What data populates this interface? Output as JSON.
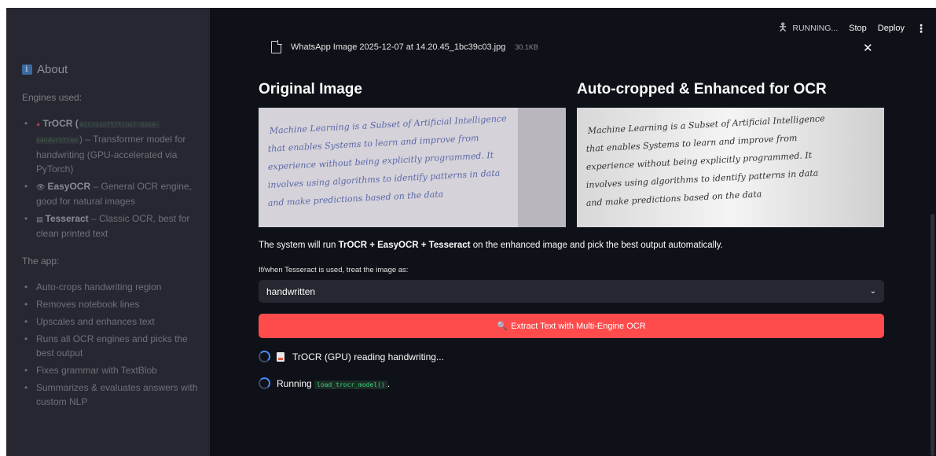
{
  "header": {
    "running_label": "RUNNING...",
    "stop_label": "Stop",
    "deploy_label": "Deploy",
    "menu_glyph": "⋮"
  },
  "sidebar": {
    "about_title": "About",
    "engines_heading": "Engines used:",
    "engines": [
      {
        "name": "TrOCR (",
        "code": "microsoft/trocr-base-handwritten",
        "desc": ") – Transformer model for handwriting (GPU-accelerated via PyTorch)"
      },
      {
        "name": "EasyOCR",
        "desc": " – General OCR engine, good for natural images"
      },
      {
        "name": "Tesseract",
        "desc": " – Classic OCR, best for clean printed text"
      }
    ],
    "app_heading": "The app:",
    "app_items": [
      "Auto-crops handwriting region",
      "Removes notebook lines",
      "Upscales and enhances text",
      "Runs all OCR engines and picks the best output",
      "Fixes grammar with TextBlob",
      "Summarizes & evaluates answers with custom NLP"
    ]
  },
  "file": {
    "name": "WhatsApp Image 2025-12-07 at 14.20.45_1bc39c03.jpg",
    "size": "30.1KB"
  },
  "original_heading": "Original Image",
  "enhanced_heading": "Auto-cropped & Enhanced for OCR",
  "handwriting_lines": [
    "Machine Learning is a Subset of Artificial Intelligence",
    "that enables Systems to learn and improve from",
    "experience without being explicitly programmed. It",
    "involves using algorithms to identify patterns in data",
    "and make predictions based on the data"
  ],
  "system_text": {
    "prefix": "The system will run ",
    "bold": "TrOCR + EasyOCR + Tesseract",
    "suffix": " on the enhanced image and pick the best output automatically."
  },
  "tesseract_label": "If/when Tesseract is used, treat the image as:",
  "select_value": "handwritten",
  "extract_button": "Extract Text with Multi-Engine OCR",
  "status_trocr": "TrOCR (GPU) reading handwriting...",
  "status_running_prefix": "Running ",
  "status_running_code": "load_trocr_model()",
  "status_running_suffix": ".",
  "colors": {
    "background": "#0e1117",
    "sidebar": "#262730",
    "primary_button": "#ff4b4b",
    "spinner": "#4a8cff"
  }
}
